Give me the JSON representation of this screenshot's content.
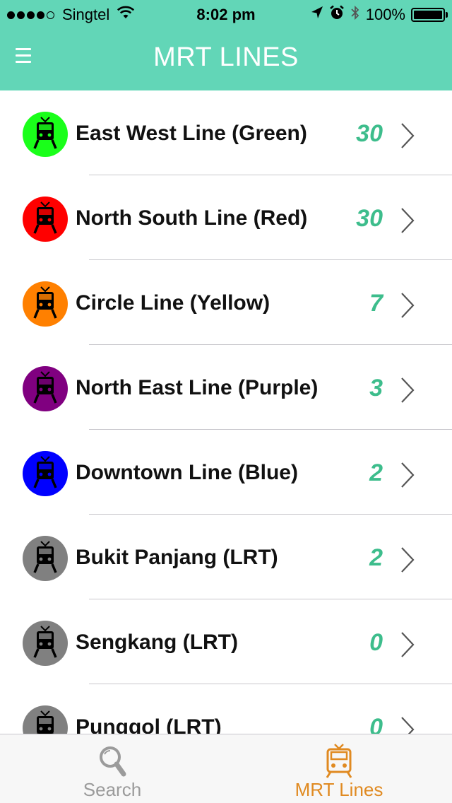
{
  "status_bar": {
    "carrier": "Singtel",
    "time": "8:02 pm",
    "battery": "100%",
    "signal_bars_filled": 4,
    "signal_bars_total": 5
  },
  "nav": {
    "title": "MRT LINES",
    "menu_icon": "hamburger-icon"
  },
  "colors": {
    "header_bg": "#62d6b7",
    "count_color": "#3dbd8c",
    "active_tab": "#e08a21",
    "inactive_tab": "#9b9b9b"
  },
  "lines": [
    {
      "label": "East West Line (Green)",
      "count": "30",
      "icon_color": "#1aff1a"
    },
    {
      "label": "North South Line (Red)",
      "count": "30",
      "icon_color": "#ff0000"
    },
    {
      "label": "Circle Line (Yellow)",
      "count": "7",
      "icon_color": "#ff8000"
    },
    {
      "label": "North East Line (Purple)",
      "count": "3",
      "icon_color": "#800080"
    },
    {
      "label": "Downtown Line (Blue)",
      "count": "2",
      "icon_color": "#0000ff"
    },
    {
      "label": "Bukit Panjang (LRT)",
      "count": "2",
      "icon_color": "#808080"
    },
    {
      "label": "Sengkang (LRT)",
      "count": "0",
      "icon_color": "#808080"
    },
    {
      "label": "Punggol (LRT)",
      "count": "0",
      "icon_color": "#808080"
    }
  ],
  "tabs": [
    {
      "label": "Search",
      "icon": "search-icon",
      "active": false
    },
    {
      "label": "MRT Lines",
      "icon": "train-icon",
      "active": true
    }
  ]
}
